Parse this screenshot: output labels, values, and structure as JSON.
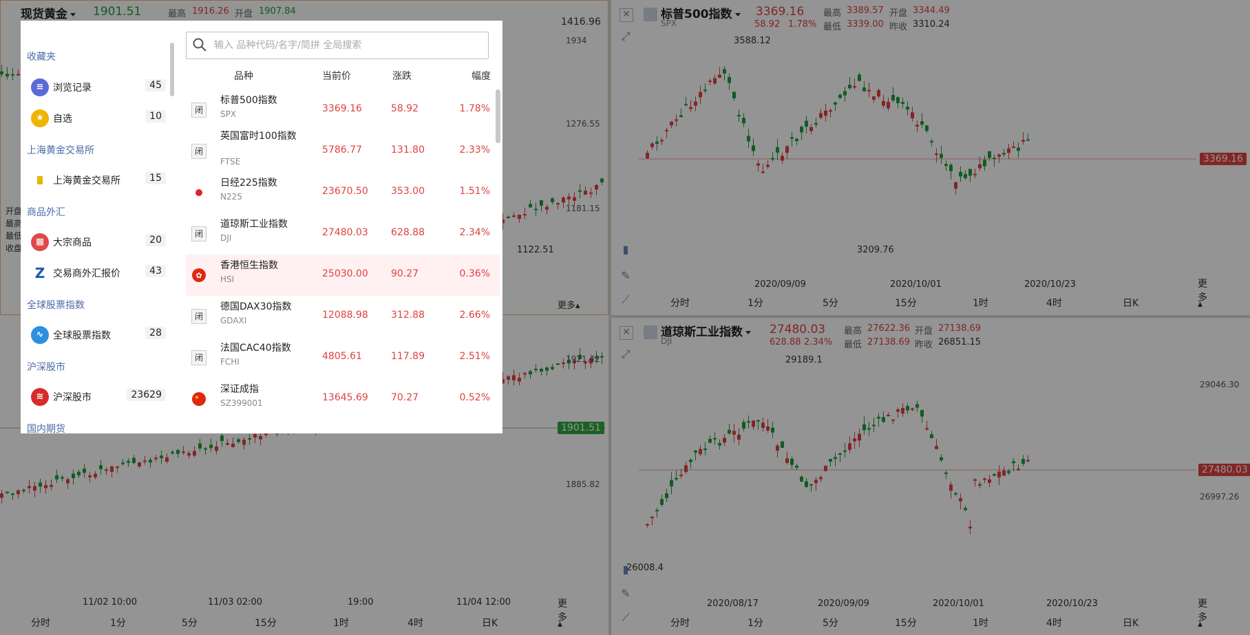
{
  "gold": {
    "title": "现货黄金",
    "price": "1901.51",
    "high_label": "最高",
    "high": "1916.26",
    "open_label": "开盘",
    "open": "1907.84",
    "ext_value": "1416.96",
    "axis_labels": [
      "1934",
      "1276.55",
      "1181.15",
      "1921.42",
      "1885.82"
    ],
    "low_mark": "1122.51",
    "price_tag": "1901.51",
    "info_labels": [
      "开盘",
      "最高",
      "最低",
      "收盘"
    ],
    "dates": [
      "11/02 10:00",
      "11/03 02:00",
      "19:00",
      "11/04 12:00"
    ],
    "timeframes": [
      "分时",
      "1分",
      "5分",
      "15分",
      "1时",
      "4时",
      "日K",
      "更多"
    ],
    "top_more": "更多"
  },
  "spx": {
    "title": "标普500指数",
    "code": "SPX",
    "price": "3369.16",
    "change": "58.92",
    "pct": "1.78%",
    "high_label": "最高",
    "high": "3389.57",
    "open_label": "开盘",
    "open": "3344.49",
    "low_label": "最低",
    "low": "3339.00",
    "prev_label": "昨收",
    "prev": "3310.24",
    "peak": "3588.12",
    "trough": "3209.76",
    "price_tag": "3369.16",
    "dates": [
      "2020/09/09",
      "2020/10/01",
      "2020/10/23"
    ],
    "timeframes": [
      "分时",
      "1分",
      "5分",
      "15分",
      "1时",
      "4时",
      "日K",
      "更多"
    ]
  },
  "dji": {
    "title": "道琼斯工业指数",
    "code": "DJI",
    "price": "27480.03",
    "change": "628.88",
    "pct": "2.34%",
    "high_label": "最高",
    "high": "27622.36",
    "open_label": "开盘",
    "open": "27138.69",
    "low_label": "最低",
    "low": "27138.69",
    "prev_label": "昨收",
    "prev": "26851.15",
    "peak": "29189.1",
    "trough": "26008.4",
    "axis_labels": [
      "29046.30",
      "26997.26"
    ],
    "price_tag": "27480.03",
    "dates": [
      "2020/08/17",
      "2020/09/09",
      "2020/10/01",
      "2020/10/23"
    ],
    "timeframes": [
      "分时",
      "1分",
      "5分",
      "15分",
      "1时",
      "4时",
      "日K",
      "更多"
    ]
  },
  "modal": {
    "search_placeholder": "输入 品种代码/名字/简拼 全局搜索",
    "sidebar": {
      "groups": [
        {
          "title": "收藏夹",
          "items": [
            {
              "name": "浏览记录",
              "count": "45",
              "icon": "history-icon"
            },
            {
              "name": "自选",
              "count": "10",
              "icon": "star-icon"
            }
          ]
        },
        {
          "title": "上海黄金交易所",
          "items": [
            {
              "name": "上海黄金交易所",
              "count": "15",
              "icon": "sge-icon"
            }
          ]
        },
        {
          "title": "商品外汇",
          "items": [
            {
              "name": "大宗商品",
              "count": "20",
              "icon": "commodity-icon"
            },
            {
              "name": "交易商外汇报价",
              "count": "43",
              "icon": "forex-icon"
            }
          ]
        },
        {
          "title": "全球股票指数",
          "items": [
            {
              "name": "全球股票指数",
              "count": "28",
              "icon": "global-index-icon"
            }
          ]
        },
        {
          "title": "沪深股市",
          "items": [
            {
              "name": "沪深股市",
              "count": "23629",
              "icon": "a-share-icon"
            }
          ]
        },
        {
          "title": "国内期货",
          "items": []
        }
      ]
    },
    "columns": [
      "品种",
      "当前价",
      "涨跌",
      "幅度"
    ],
    "rows": [
      {
        "name": "标普500指数",
        "code": "SPX",
        "price": "3369.16",
        "change": "58.92",
        "pct": "1.78%",
        "badge": "闭",
        "flag": "closed"
      },
      {
        "name": "英国富时100指数",
        "code": "FTSE",
        "price": "5786.77",
        "change": "131.80",
        "pct": "2.33%",
        "badge": "闭",
        "flag": "closed"
      },
      {
        "name": "日经225指数",
        "code": "N225",
        "price": "23670.50",
        "change": "353.00",
        "pct": "1.51%",
        "badge": "",
        "flag": "japan"
      },
      {
        "name": "道琼斯工业指数",
        "code": "DJI",
        "price": "27480.03",
        "change": "628.88",
        "pct": "2.34%",
        "badge": "闭",
        "flag": "closed"
      },
      {
        "name": "香港恒生指数",
        "code": "HSI",
        "price": "25030.00",
        "change": "90.27",
        "pct": "0.36%",
        "badge": "",
        "flag": "hongkong"
      },
      {
        "name": "德国DAX30指数",
        "code": "GDAXI",
        "price": "12088.98",
        "change": "312.88",
        "pct": "2.66%",
        "badge": "闭",
        "flag": "closed"
      },
      {
        "name": "法国CAC40指数",
        "code": "FCHI",
        "price": "4805.61",
        "change": "117.89",
        "pct": "2.51%",
        "badge": "闭",
        "flag": "closed"
      },
      {
        "name": "深证成指",
        "code": "SZ399001",
        "price": "13645.69",
        "change": "70.27",
        "pct": "0.52%",
        "badge": "",
        "flag": "china"
      }
    ]
  },
  "colors": {
    "up": "#e04040",
    "down": "#1f9d3a",
    "accent": "#4a6aa8",
    "highlight_row": "#fff1f1"
  }
}
